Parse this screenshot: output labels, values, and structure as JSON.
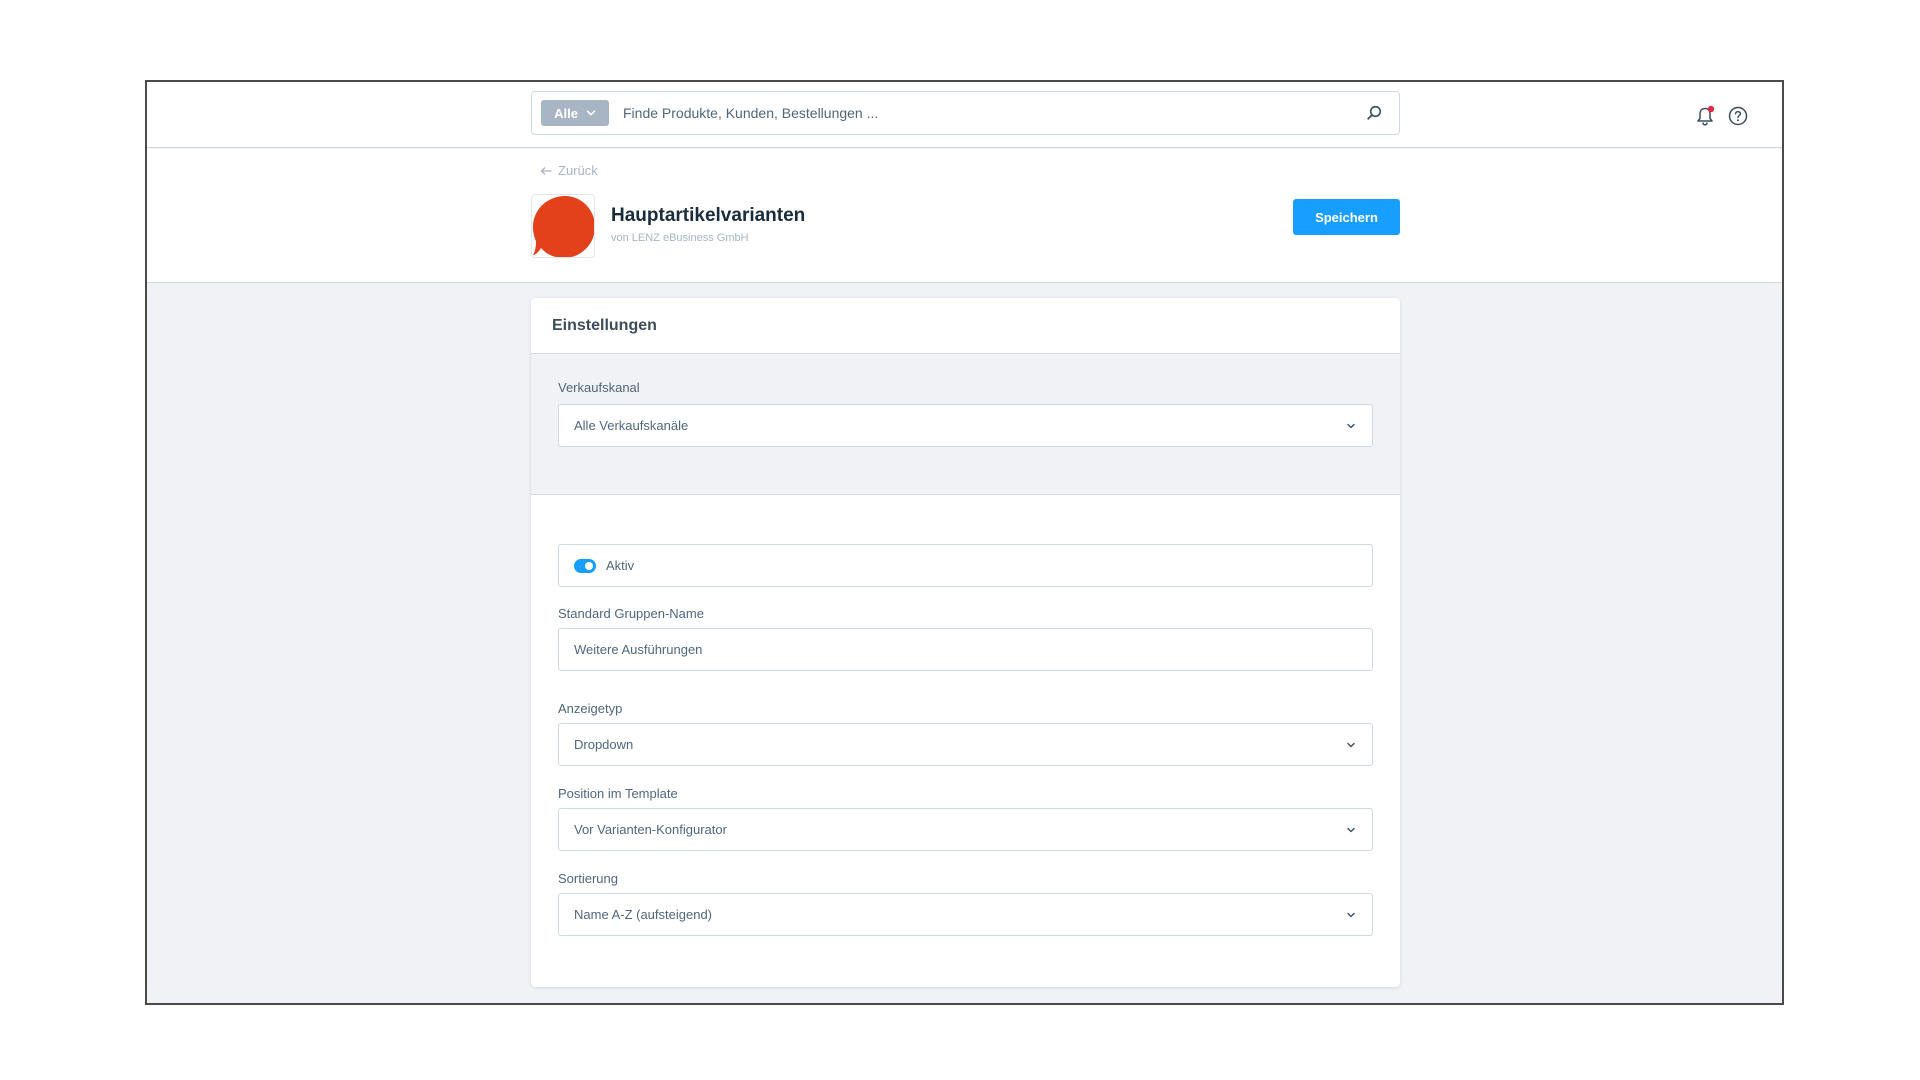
{
  "topbar": {
    "search_scope_label": "Alle",
    "search_placeholder": "Finde Produkte, Kunden, Bestellungen ...",
    "notification_badge_color": "#de294c"
  },
  "header": {
    "back_label": "Zurück",
    "app_title": "Hauptartikelvarianten",
    "app_vendor": "von LENZ eBusiness GmbH",
    "save_label": "Speichern",
    "logo_color": "#e3411c"
  },
  "card": {
    "title": "Einstellungen",
    "sales_channel": {
      "label": "Verkaufskanal",
      "value": "Alle Verkaufskanäle"
    },
    "active": {
      "label": "Aktiv",
      "enabled": true
    },
    "group_name": {
      "label": "Standard Gruppen-Name",
      "value": "Weitere Ausführungen"
    },
    "display_type": {
      "label": "Anzeigetyp",
      "value": "Dropdown"
    },
    "template_position": {
      "label": "Position im Template",
      "value": "Vor Varianten-Konfigurator"
    },
    "sorting": {
      "label": "Sortierung",
      "value": "Name A-Z (aufsteigend)"
    }
  },
  "colors": {
    "primary": "#189eff",
    "text": "#52667a",
    "border": "#d1d9e0",
    "background": "#f0f2f5"
  }
}
